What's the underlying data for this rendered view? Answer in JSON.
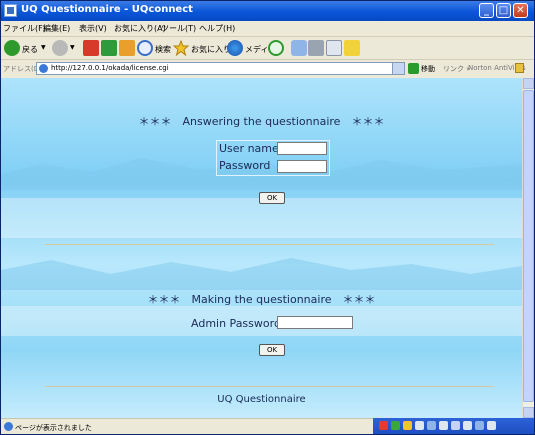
{
  "window": {
    "title": "UQ Questionnaire - UQconnect",
    "minimize": "_",
    "maximize": "□",
    "close": "✕"
  },
  "menu": [
    "ファイル(F)",
    "編集(E)",
    "表示(V)",
    "お気に入り(A)",
    "ツール(T)",
    "ヘルプ(H)"
  ],
  "toolbar": {
    "back": "戻る",
    "search": "検索",
    "favorites": "お気に入り",
    "media": "メディア"
  },
  "address": {
    "label": "アドレス(D)",
    "url": "http://127.0.0.1/okada/license.cgi",
    "go": "移動",
    "links": "リンク »",
    "norton": "Norton AntiVirus"
  },
  "page": {
    "answer_heading": "＊＊＊　Answering the questionnaire　＊＊＊",
    "username_label": "User name",
    "password_label": "Password",
    "ok1": "OK",
    "make_heading": "＊＊＊　Making the questionnaire　＊＊＊",
    "admin_label": "Admin Password",
    "ok2": "OK",
    "footer": "UQ Questionnaire"
  },
  "status": {
    "text": "ページが表示されました"
  },
  "colors": {
    "titlebar": "#0a56d8",
    "background": "#8fd6f6",
    "text": "#1b2a56"
  }
}
